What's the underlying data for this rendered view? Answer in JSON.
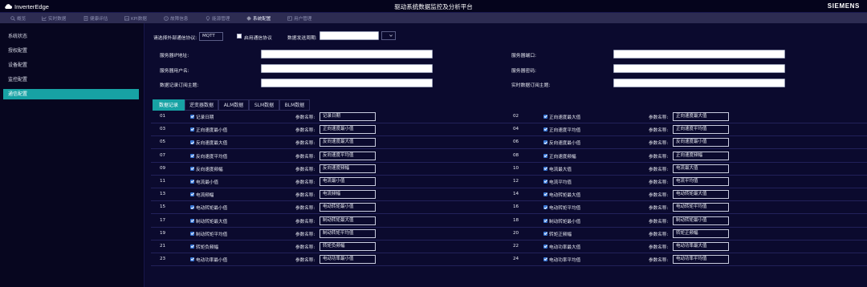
{
  "header": {
    "logo_text": "InverterEdge",
    "title": "驱动系统数据监控及分析平台",
    "brand": "SIEMENS"
  },
  "nav": [
    {
      "label": "概览",
      "icon": "search-icon",
      "active": false
    },
    {
      "label": "实时数据",
      "icon": "chart-icon",
      "active": false
    },
    {
      "label": "健康评估",
      "icon": "document-icon",
      "active": false
    },
    {
      "label": "KPI数据",
      "icon": "image-icon",
      "active": false
    },
    {
      "label": "故障信息",
      "icon": "warning-icon",
      "active": false
    },
    {
      "label": "能源管理",
      "icon": "bulb-icon",
      "active": false
    },
    {
      "label": "系统配置",
      "icon": "gear-icon",
      "active": true
    },
    {
      "label": "用户管理",
      "icon": "users-icon",
      "active": false
    }
  ],
  "sidebar": {
    "items": [
      {
        "label": "系统状态",
        "active": false
      },
      {
        "label": "授权配置",
        "active": false
      },
      {
        "label": "设备配置",
        "active": false
      },
      {
        "label": "监控配置",
        "active": false
      },
      {
        "label": "通信配置",
        "active": true
      }
    ]
  },
  "config": {
    "protocol_label": "请选择外部通信协议:",
    "protocol_value": "MQTT",
    "enable_label": "启用通信协议",
    "period_label": "数据发送周期:",
    "period_value": "",
    "period_unit": "",
    "server_ip_label": "服务器IP地址:",
    "server_ip_value": "",
    "server_port_label": "服务器端口:",
    "server_port_value": "",
    "server_user_label": "服务器用户名:",
    "server_user_value": "",
    "server_pwd_label": "服务器密码:",
    "server_pwd_value": "",
    "record_topic_label": "数据记录订阅主题:",
    "record_topic_value": "",
    "realtime_topic_label": "实时数据订阅主题:",
    "realtime_topic_value": ""
  },
  "tabs": [
    {
      "label": "数据记录",
      "active": true
    },
    {
      "label": "逆变器数据",
      "active": false
    },
    {
      "label": "ALM数据",
      "active": false
    },
    {
      "label": "SLM数据",
      "active": false
    },
    {
      "label": "BLM数据",
      "active": false
    }
  ],
  "param_label": "参数名称:",
  "rows": [
    {
      "left": {
        "num": "01",
        "name": "记录日期",
        "value": "记录日期"
      },
      "right": {
        "num": "02",
        "name": "正向速度最大值",
        "value": "正向速度最大值"
      }
    },
    {
      "left": {
        "num": "03",
        "name": "正向速度最小值",
        "value": "正向速度最小值"
      },
      "right": {
        "num": "04",
        "name": "正向速度平均值",
        "value": "正向速度平均值"
      }
    },
    {
      "left": {
        "num": "05",
        "name": "反向速度最大值",
        "value": "反向速度最大值"
      },
      "right": {
        "num": "06",
        "name": "反向速度最小值",
        "value": "反向速度最小值"
      }
    },
    {
      "left": {
        "num": "07",
        "name": "反向速度平均值",
        "value": "反向速度平均值"
      },
      "right": {
        "num": "08",
        "name": "正向速度频幅",
        "value": "正向速度频幅"
      }
    },
    {
      "left": {
        "num": "09",
        "name": "反向速度频幅",
        "value": "反向速度频幅"
      },
      "right": {
        "num": "10",
        "name": "电流最大值",
        "value": "电流最大值"
      }
    },
    {
      "left": {
        "num": "11",
        "name": "电流最小值",
        "value": "电流最小值"
      },
      "right": {
        "num": "12",
        "name": "电流平均值",
        "value": "电流平均值"
      }
    },
    {
      "left": {
        "num": "13",
        "name": "电流频幅",
        "value": "电流频幅"
      },
      "right": {
        "num": "14",
        "name": "电动转矩最大值",
        "value": "电动转矩最大值"
      }
    },
    {
      "left": {
        "num": "15",
        "name": "电动转矩最小值",
        "value": "电动转矩最小值"
      },
      "right": {
        "num": "16",
        "name": "电动转矩平均值",
        "value": "电动转矩平均值"
      }
    },
    {
      "left": {
        "num": "17",
        "name": "制动转矩最大值",
        "value": "制动转矩最大值"
      },
      "right": {
        "num": "18",
        "name": "制动转矩最小值",
        "value": "制动转矩最小值"
      }
    },
    {
      "left": {
        "num": "19",
        "name": "制动转矩平均值",
        "value": "制动转矩平均值"
      },
      "right": {
        "num": "20",
        "name": "转矩正频幅",
        "value": "转矩正频幅"
      }
    },
    {
      "left": {
        "num": "21",
        "name": "转矩负频幅",
        "value": "转矩负频幅"
      },
      "right": {
        "num": "22",
        "name": "电动功率最大值",
        "value": "电动功率最大值"
      }
    },
    {
      "left": {
        "num": "23",
        "name": "电动功率最小值",
        "value": "电动功率最小值"
      },
      "right": {
        "num": "24",
        "name": "电动功率平均值",
        "value": "电动功率平均值"
      }
    }
  ]
}
